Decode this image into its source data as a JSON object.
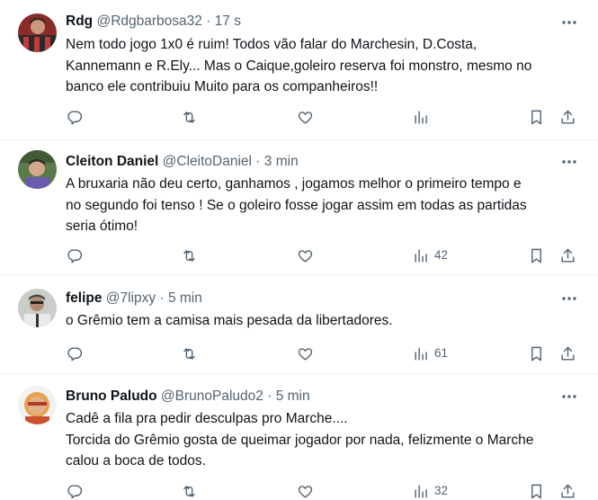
{
  "tweets": [
    {
      "name": "Rdg",
      "handle": "@Rdgbarbosa32",
      "separator": "·",
      "time": "17 s",
      "text": "Nem todo jogo 1x0 é ruim! Todos vão falar do Marchesin, D.Costa,\nKannemann e R.Ely... Mas o Caique,goleiro reserva foi monstro, mesmo no\nbanco ele contribuiu Muito para os companheiros!!",
      "views": "",
      "avatar_color": "#b73a3a"
    },
    {
      "name": "Cleiton Daniel",
      "handle": "@CleitoDaniel",
      "separator": "·",
      "time": "3 min",
      "text": "A bruxaria não deu certo, ganhamos , jogamos melhor o primeiro tempo e\nno segundo foi tenso ! Se o goleiro fosse jogar assim em todas as partidas\nseria ótimo!",
      "views": "42",
      "avatar_color": "#4a6a3a"
    },
    {
      "name": "felipe",
      "handle": "@7lipxy",
      "separator": "·",
      "time": "5 min",
      "text": "o Grêmio tem a camisa mais pesada da libertadores.",
      "views": "61",
      "avatar_color": "#9aa39a"
    },
    {
      "name": "Bruno Paludo",
      "handle": "@BrunoPaludo2",
      "separator": "·",
      "time": "5 min",
      "text": "Cadê a fila pra pedir desculpas pro Marche....\nTorcida do Grêmio gosta de queimar jogador por nada, felizmente o Marche\ncalou a boca de todos.",
      "views": "32",
      "avatar_color": "#d98a3a"
    }
  ],
  "icons": {
    "reply": "reply-icon",
    "retweet": "retweet-icon",
    "like": "like-icon",
    "views": "views-icon",
    "bookmark": "bookmark-icon",
    "share": "share-icon",
    "more": "more-icon"
  },
  "colors": {
    "text_primary": "#0f1419",
    "text_secondary": "#536471",
    "divider": "#eff3f4"
  }
}
